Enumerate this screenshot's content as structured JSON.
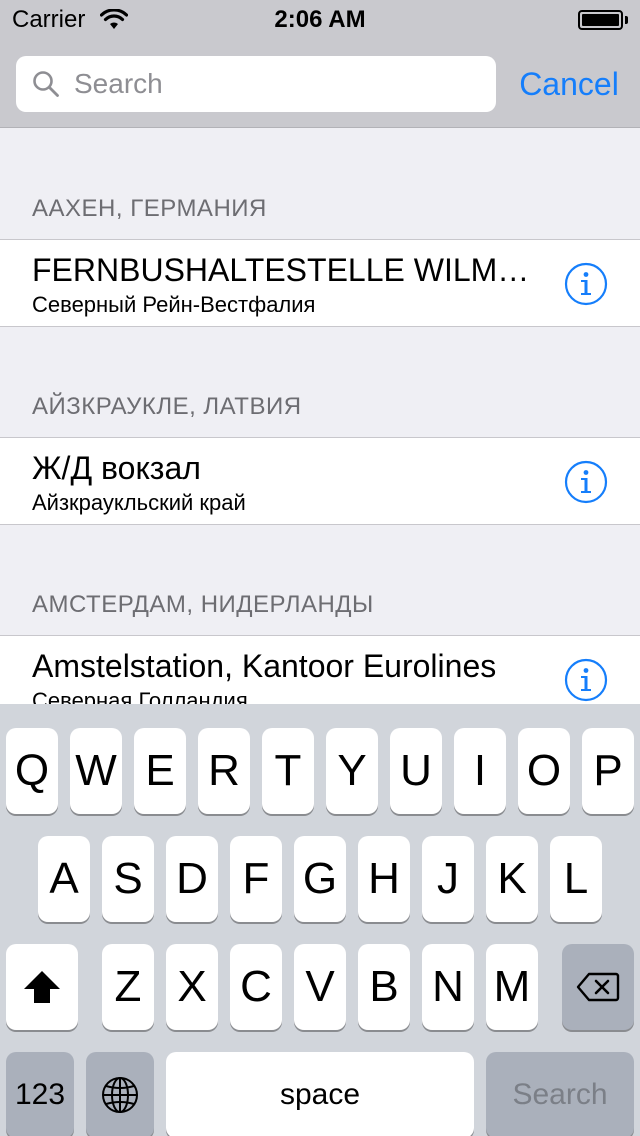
{
  "status_bar": {
    "carrier": "Carrier",
    "time": "2:06 AM"
  },
  "search": {
    "placeholder": "Search",
    "value": "",
    "cancel_label": "Cancel"
  },
  "sections": [
    {
      "header": "ААХЕН, ГЕРМАНИЯ",
      "title": "FERNBUSHALTESTELLE WILMERSDORFER",
      "subtitle": "Северный Рейн-Вестфалия"
    },
    {
      "header": "АЙЗКРАУКЛЕ, ЛАТВИЯ",
      "title": "Ж/Д вокзал",
      "subtitle": "Айзкраукльский край"
    },
    {
      "header": "АМСТЕРДАМ, НИДЕРЛАНДЫ",
      "title": "Amstelstation, Kantoor Eurolines",
      "subtitle": "Северная Голландия"
    }
  ],
  "keyboard": {
    "row1": [
      "Q",
      "W",
      "E",
      "R",
      "T",
      "Y",
      "U",
      "I",
      "O",
      "P"
    ],
    "row2": [
      "A",
      "S",
      "D",
      "F",
      "G",
      "H",
      "J",
      "K",
      "L"
    ],
    "row3": [
      "Z",
      "X",
      "C",
      "V",
      "B",
      "N",
      "M"
    ],
    "numbers_label": "123",
    "space_label": "space",
    "return_label": "Search"
  },
  "colors": {
    "accent": "#157efb",
    "header_bg": "#c9c9ce",
    "list_bg": "#efeff4",
    "keyboard_bg": "#d1d5db"
  },
  "icons": {
    "search": "magnifier-icon",
    "info": "info-circle-icon",
    "shift": "shift-arrow-icon",
    "delete": "backspace-icon",
    "globe": "globe-icon"
  }
}
